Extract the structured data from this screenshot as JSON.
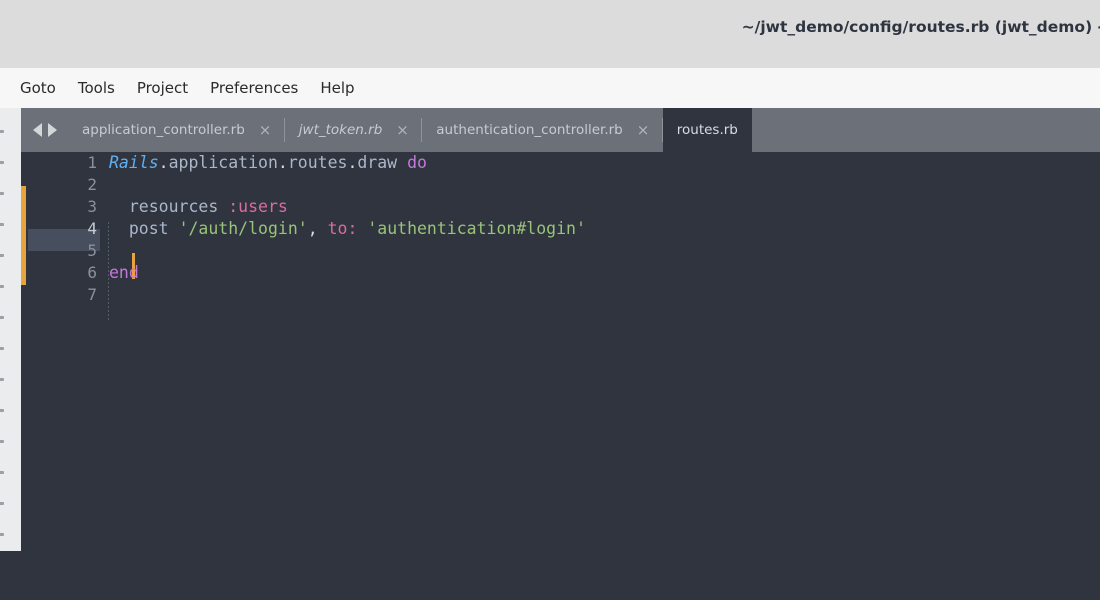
{
  "window": {
    "title": "~/jwt_demo/config/routes.rb (jwt_demo) -"
  },
  "menubar": {
    "items": [
      {
        "label": "Goto"
      },
      {
        "label": "Tools"
      },
      {
        "label": "Project"
      },
      {
        "label": "Preferences"
      },
      {
        "label": "Help"
      }
    ]
  },
  "tabbar": {
    "nav_prev_icon": "triangle-left-icon",
    "nav_next_icon": "triangle-right-icon",
    "close_glyph": "×",
    "tabs": [
      {
        "label": "application_controller.rb",
        "active": false,
        "italic": false,
        "closable": true
      },
      {
        "label": "jwt_token.rb",
        "active": false,
        "italic": true,
        "closable": true
      },
      {
        "label": "authentication_controller.rb",
        "active": false,
        "italic": false,
        "closable": true
      },
      {
        "label": "routes.rb",
        "active": true,
        "italic": false,
        "closable": false
      }
    ]
  },
  "editor": {
    "filename": "routes.rb",
    "cursor_line": 4,
    "modified_marker_color": "#e8a33d",
    "background_color": "#2f343e",
    "line_numbers": [
      "1",
      "2",
      "3",
      "4",
      "5",
      "6",
      "7"
    ],
    "lines": [
      {
        "number": "1",
        "tokens": [
          {
            "text": "Rails",
            "type": "const"
          },
          {
            "text": ".",
            "type": "punct"
          },
          {
            "text": "application",
            "type": "meth"
          },
          {
            "text": ".",
            "type": "punct"
          },
          {
            "text": "routes",
            "type": "meth"
          },
          {
            "text": ".",
            "type": "punct"
          },
          {
            "text": "draw",
            "type": "meth"
          },
          {
            "text": " ",
            "type": "plain"
          },
          {
            "text": "do",
            "type": "kw"
          }
        ]
      },
      {
        "number": "2",
        "tokens": []
      },
      {
        "number": "3",
        "tokens": [
          {
            "text": "  ",
            "type": "plain"
          },
          {
            "text": "resources",
            "type": "meth"
          },
          {
            "text": " ",
            "type": "plain"
          },
          {
            "text": ":users",
            "type": "sym"
          }
        ]
      },
      {
        "number": "4",
        "tokens": [
          {
            "text": "  ",
            "type": "plain"
          },
          {
            "text": "post",
            "type": "meth"
          },
          {
            "text": " ",
            "type": "plain"
          },
          {
            "text": "'/auth/login'",
            "type": "str"
          },
          {
            "text": ",",
            "type": "punct"
          },
          {
            "text": " ",
            "type": "plain"
          },
          {
            "text": "to:",
            "type": "sym"
          },
          {
            "text": " ",
            "type": "plain"
          },
          {
            "text": "'authentication#login'",
            "type": "str"
          }
        ]
      },
      {
        "number": "5",
        "tokens": []
      },
      {
        "number": "6",
        "tokens": [
          {
            "text": "end",
            "type": "kw"
          }
        ]
      },
      {
        "number": "7",
        "tokens": []
      }
    ]
  },
  "sidepanel": {
    "visible": true,
    "truncated": true,
    "row_count": 14
  },
  "colors": {
    "titlebar_bg": "#dcdcdc",
    "menubar_bg": "#f7f7f7",
    "tabbar_bg": "#6b7079",
    "active_tab_bg": "#2f343e",
    "editor_bg": "#2f343e",
    "sidepanel_bg": "#eaecee",
    "accent_orange": "#e8a33d",
    "syntax_const": "#61afef",
    "syntax_keyword": "#c678dd",
    "syntax_string": "#98c379",
    "syntax_symbol": "#d96ca0",
    "syntax_method": "#abb7c9",
    "syntax_plain": "#d7dce4"
  }
}
